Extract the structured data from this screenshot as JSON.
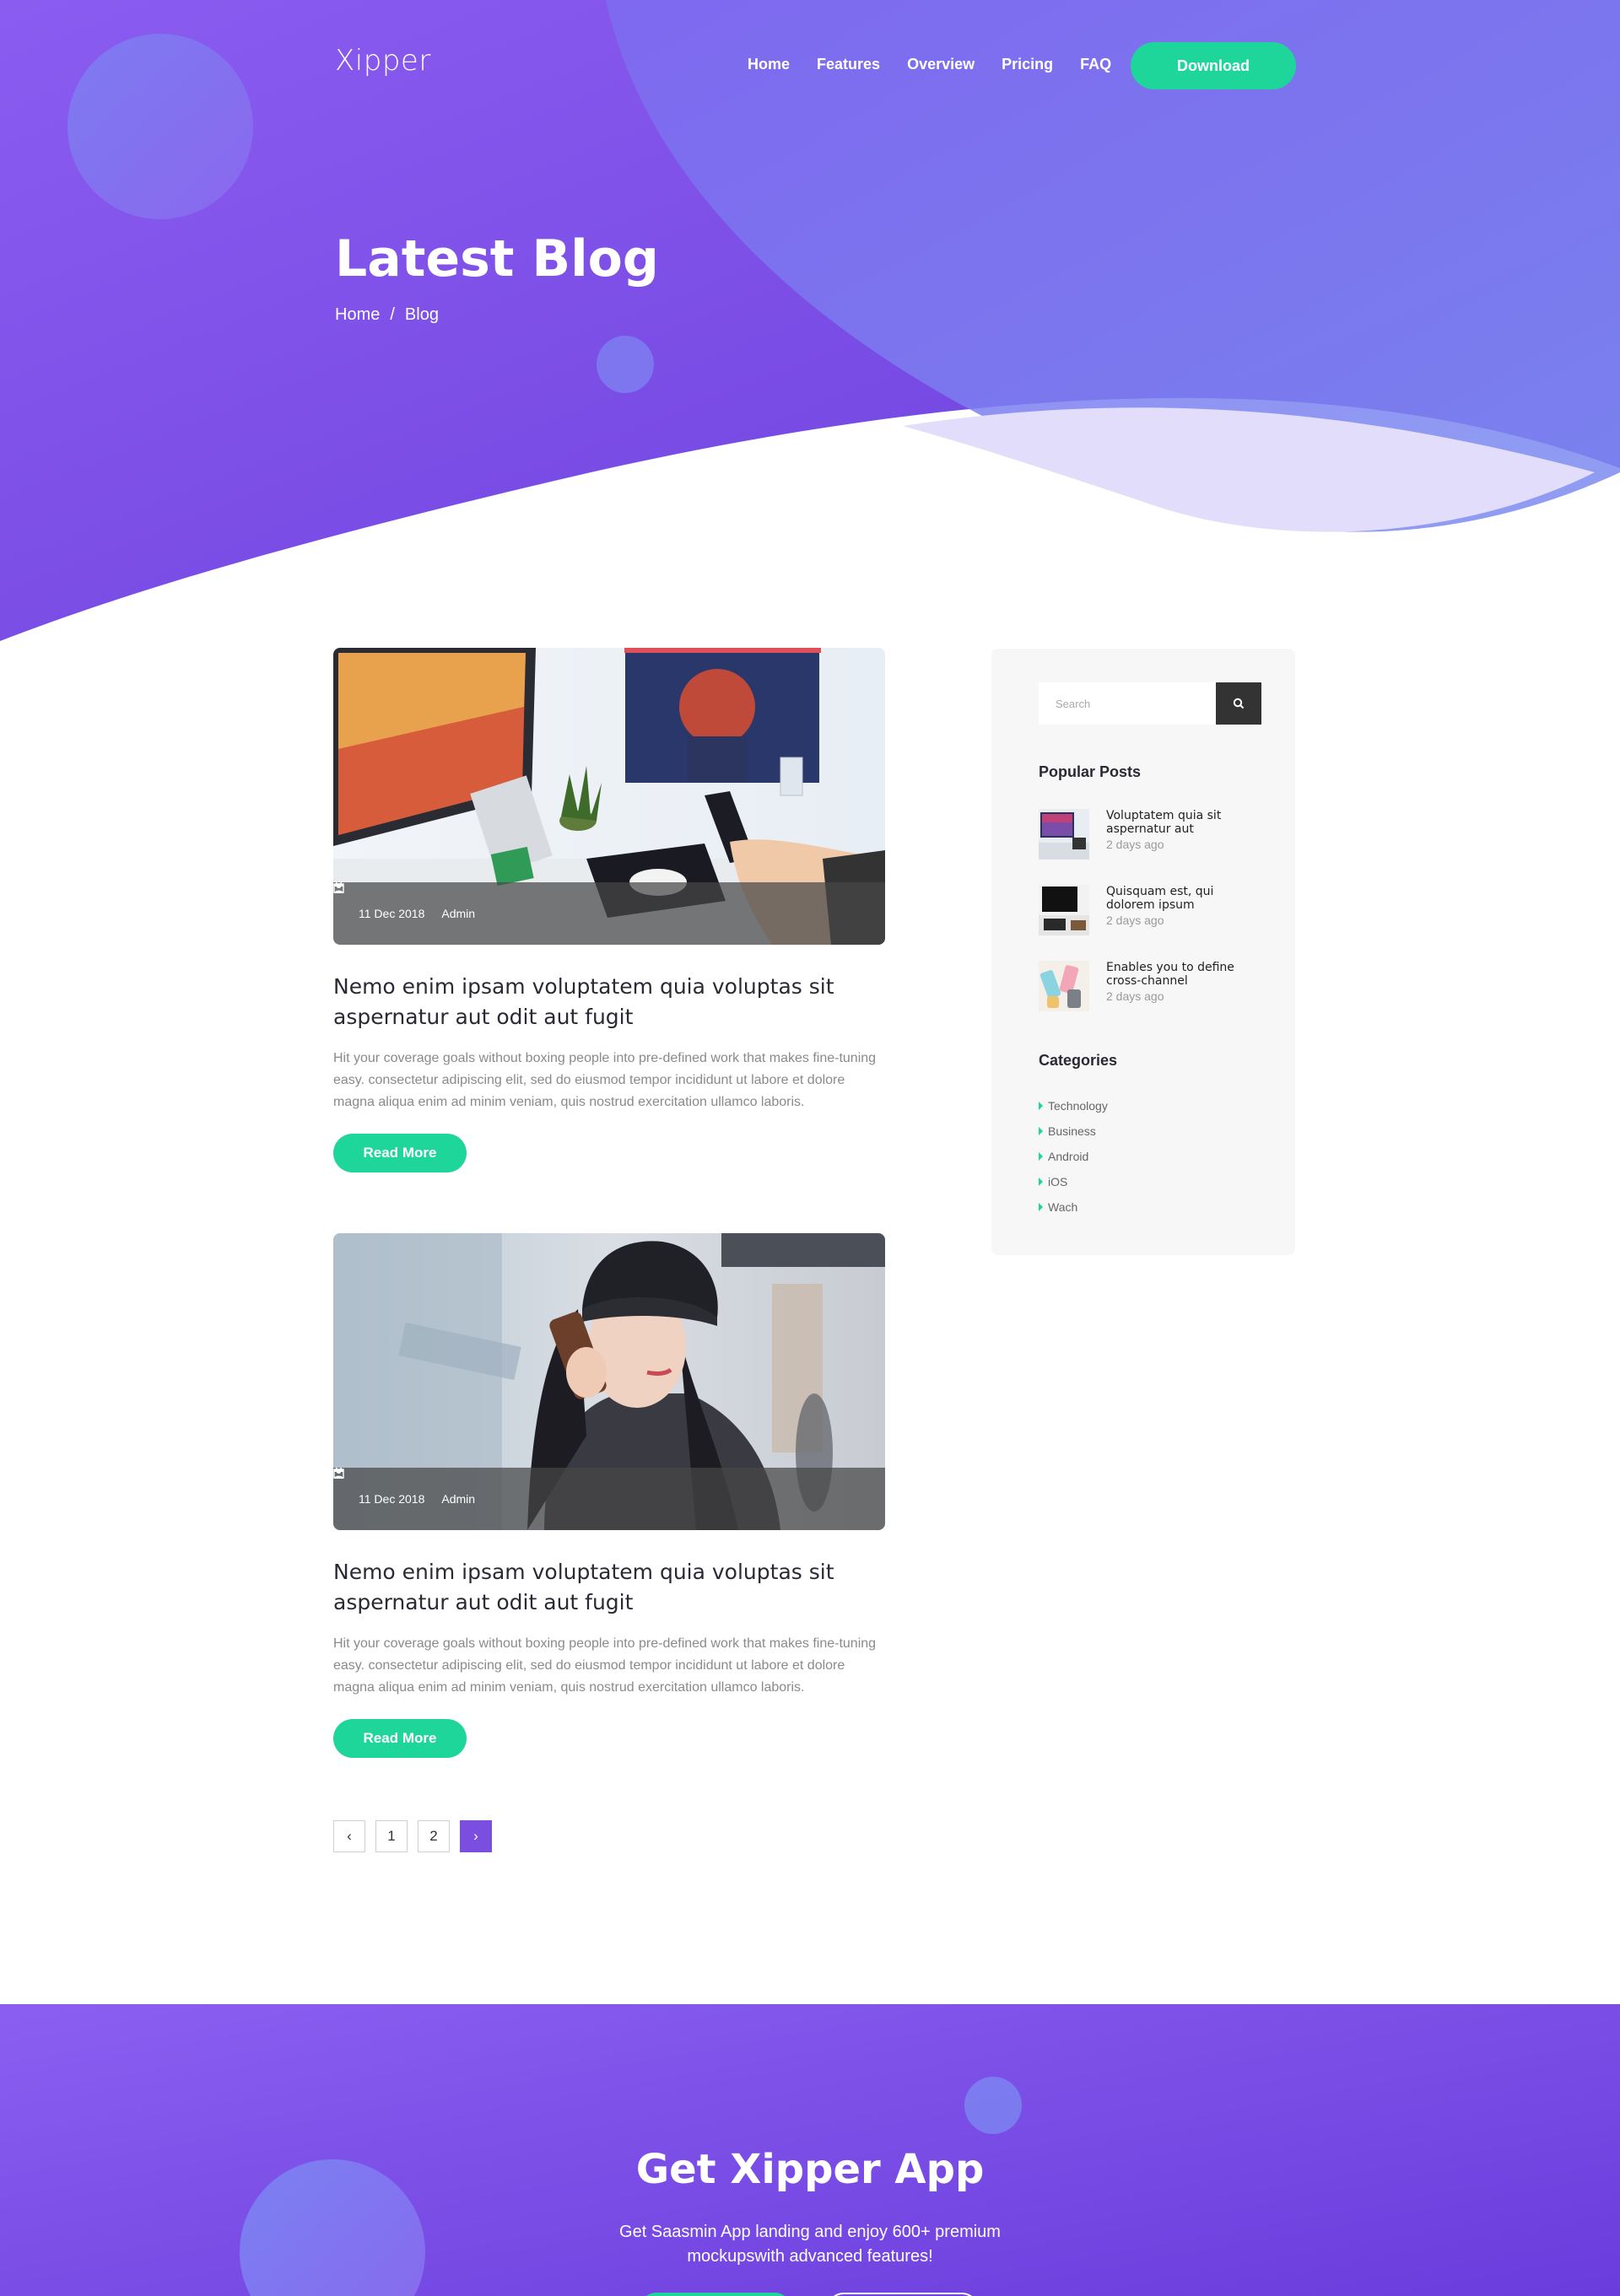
{
  "brand": {
    "logo": "Xipper"
  },
  "nav": {
    "items": [
      {
        "label": "Home"
      },
      {
        "label": "Features"
      },
      {
        "label": "Overview"
      },
      {
        "label": "Pricing"
      },
      {
        "label": "FAQ"
      }
    ],
    "download_label": "Download"
  },
  "hero": {
    "title": "Latest Blog",
    "breadcrumb": {
      "home": "Home",
      "separator": "/",
      "current": "Blog"
    }
  },
  "posts": [
    {
      "date": "11 Dec 2018",
      "author": "Admin",
      "title": "Nemo enim ipsam voluptatem quia voluptas sit aspernatur aut odit aut fugit",
      "excerpt": "Hit your coverage goals without boxing people into pre-defined work that makes fine-tuning easy. consectetur adipiscing elit, sed do eiusmod tempor incididunt ut labore et dolore magna aliqua  enim ad minim veniam, quis nostrud exercitation ullamco laboris.",
      "read_more": "Read More"
    },
    {
      "date": "11 Dec 2018",
      "author": "Admin",
      "title": "Nemo enim ipsam voluptatem quia voluptas sit aspernatur aut odit aut fugit",
      "excerpt": "Hit your coverage goals without boxing people into pre-defined work that makes fine-tuning easy. consectetur adipiscing elit, sed do eiusmod tempor incididunt ut labore et dolore magna aliqua  enim ad minim veniam, quis nostrud exercitation ullamco laboris.",
      "read_more": "Read More"
    }
  ],
  "pagination": {
    "prev": "‹",
    "pages": [
      "1",
      "2"
    ],
    "next": "›",
    "active": "next"
  },
  "sidebar": {
    "search_placeholder": "Search",
    "popular_title": "Popular Posts",
    "popular_posts": [
      {
        "title": "Voluptatem quia sit aspernatur aut",
        "date": "2 days ago"
      },
      {
        "title": "Quisquam est, qui dolorem ipsum",
        "date": "2 days ago"
      },
      {
        "title": "Enables you to define cross-channel",
        "date": "2 days ago"
      }
    ],
    "categories_title": "Categories",
    "categories": [
      "Technology",
      "Business",
      "Android",
      "iOS",
      "Wach"
    ]
  },
  "cta": {
    "title": "Get Xipper App",
    "text": "Get Saasmin App landing  and enjoy 600+ premium mockupswith advanced features!"
  },
  "colors": {
    "hero_purple": "#7b52e6",
    "hero_blue": "#6e7ff0",
    "accent_green": "#1fd69a",
    "dark": "#333333"
  },
  "icons": {
    "calendar": "calendar-icon",
    "user": "user-icon",
    "search": "search-icon",
    "category_bullet": "caret-right-icon"
  }
}
